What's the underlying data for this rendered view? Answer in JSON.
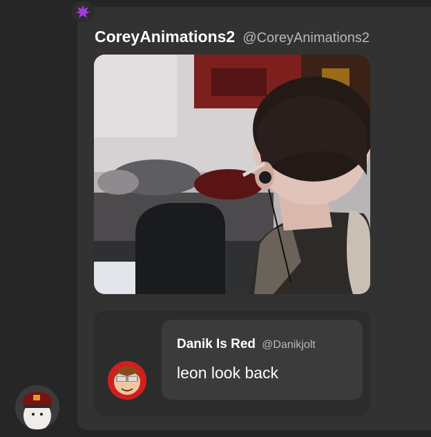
{
  "post": {
    "author_name": "CoreyAnimations2",
    "author_handle": "@CoreyAnimations2",
    "media": {
      "alt": "video-frame"
    }
  },
  "quote": {
    "author_name": "Danik Is Red",
    "author_handle": "@Danikjolt",
    "text": "leon look back"
  },
  "colors": {
    "background": "#252525",
    "card": "#323232",
    "quote_container": "#2c2c2c",
    "quote_bubble": "#3b3b3b",
    "badge_star": "#a23bd9",
    "avatar_red": "#d11f1f"
  },
  "icons": {
    "badge": "star-badge-icon"
  }
}
